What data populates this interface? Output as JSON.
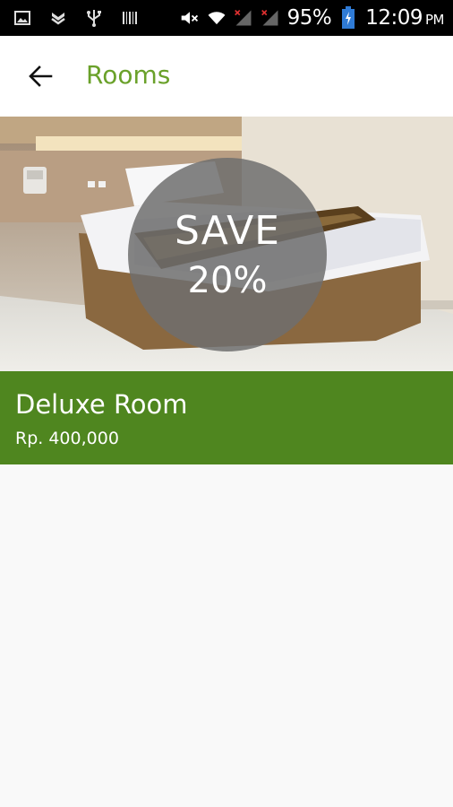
{
  "status_bar": {
    "battery_percent": "95%",
    "time": "12:09",
    "ampm": "PM"
  },
  "app_bar": {
    "title": "Rooms",
    "title_color": "#6aa12a"
  },
  "rooms": [
    {
      "name": "Deluxe Room",
      "price": "Rp. 400,000",
      "badge_line1": "SAVE",
      "badge_line2": "20%",
      "info_color": "#4f861f"
    }
  ]
}
